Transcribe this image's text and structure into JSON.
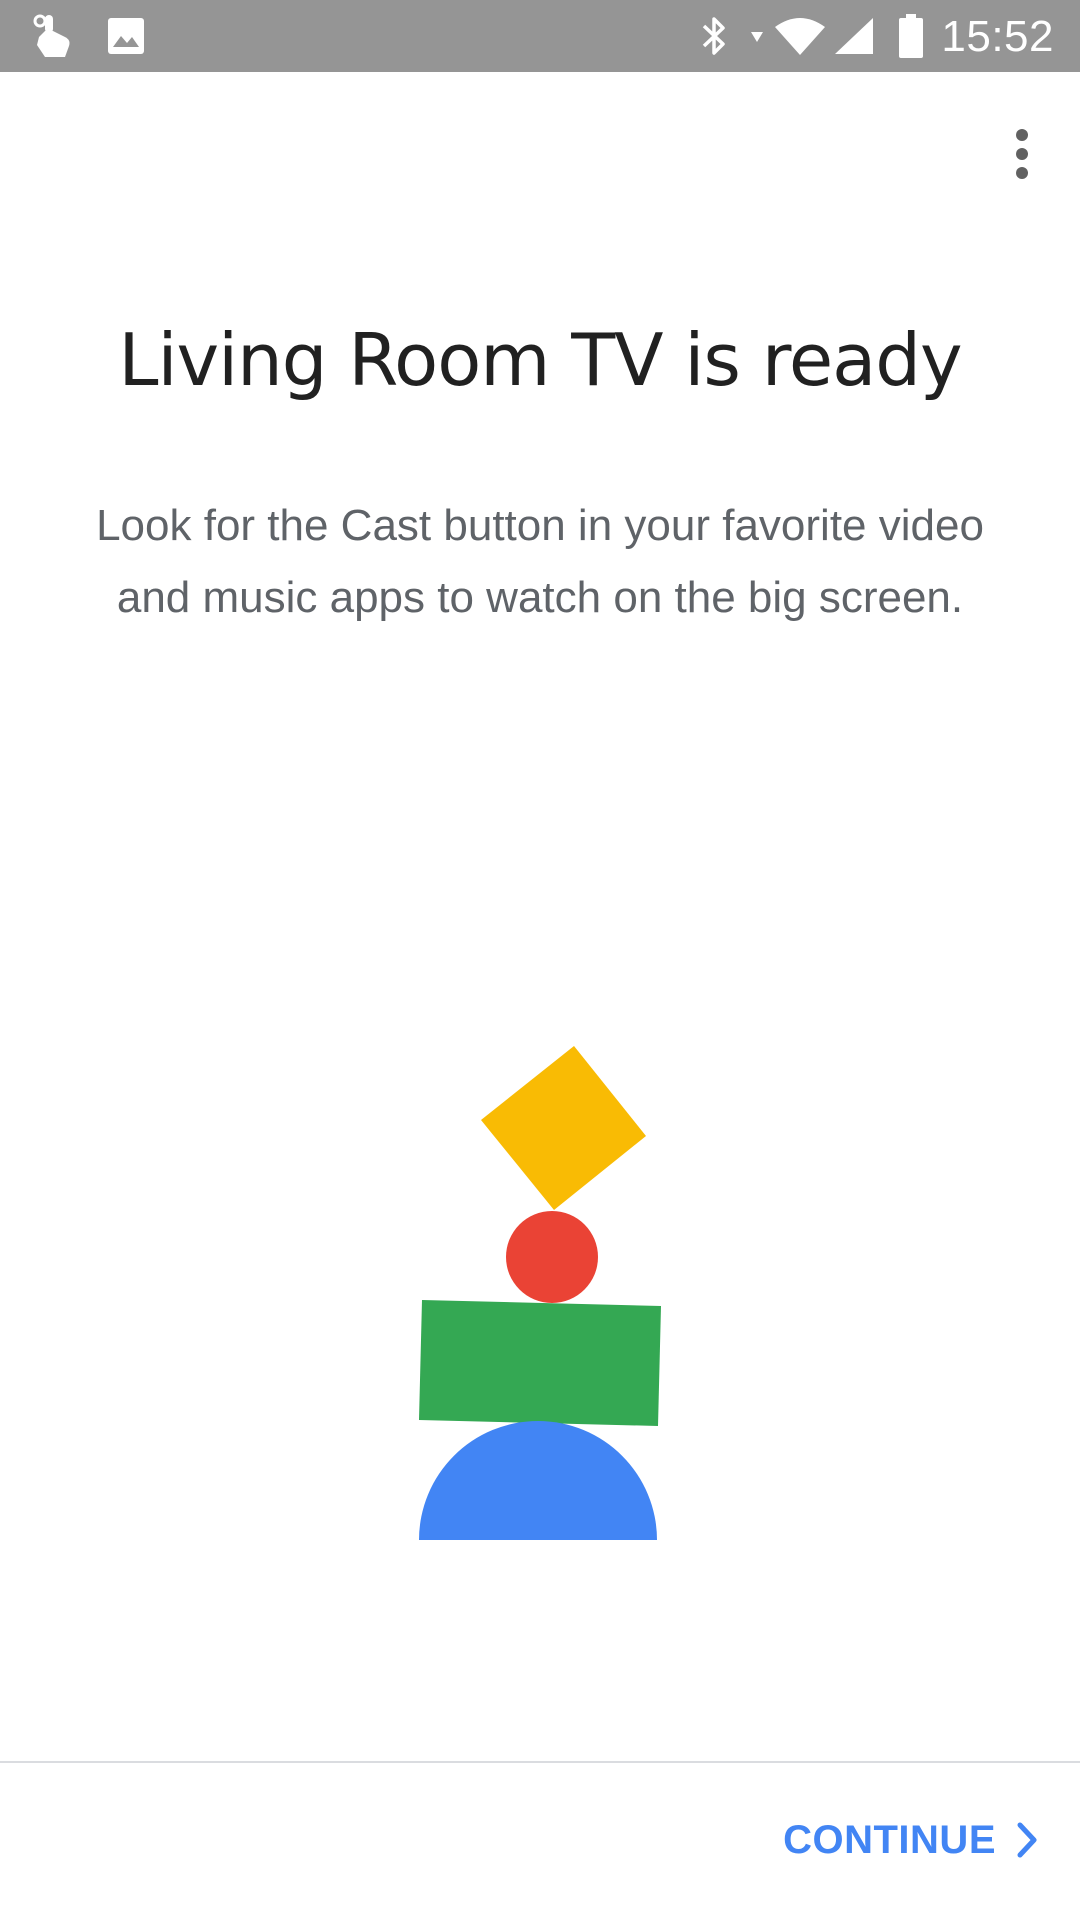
{
  "status_bar": {
    "time": "15:52",
    "icons": [
      "touch-gesture-icon",
      "image-icon",
      "bluetooth-icon",
      "wifi-icon",
      "cell-signal-icon",
      "battery-icon"
    ]
  },
  "toolbar": {
    "menu_icon": "more-vert-icon"
  },
  "main": {
    "title": "Living Room TV is ready",
    "description": "Look for the Cast button in your favorite video and music apps to watch on the big screen."
  },
  "footer": {
    "continue_label": "CONTINUE",
    "continue_icon": "chevron-right-icon"
  },
  "colors": {
    "status_bar_bg": "#959595",
    "accent_blue": "#4285f4",
    "shape_yellow": "#f9bb04",
    "shape_red": "#ea4335",
    "shape_green": "#34a853",
    "shape_blue": "#4285f4",
    "title_text": "#212121",
    "body_text": "#5f6368"
  }
}
